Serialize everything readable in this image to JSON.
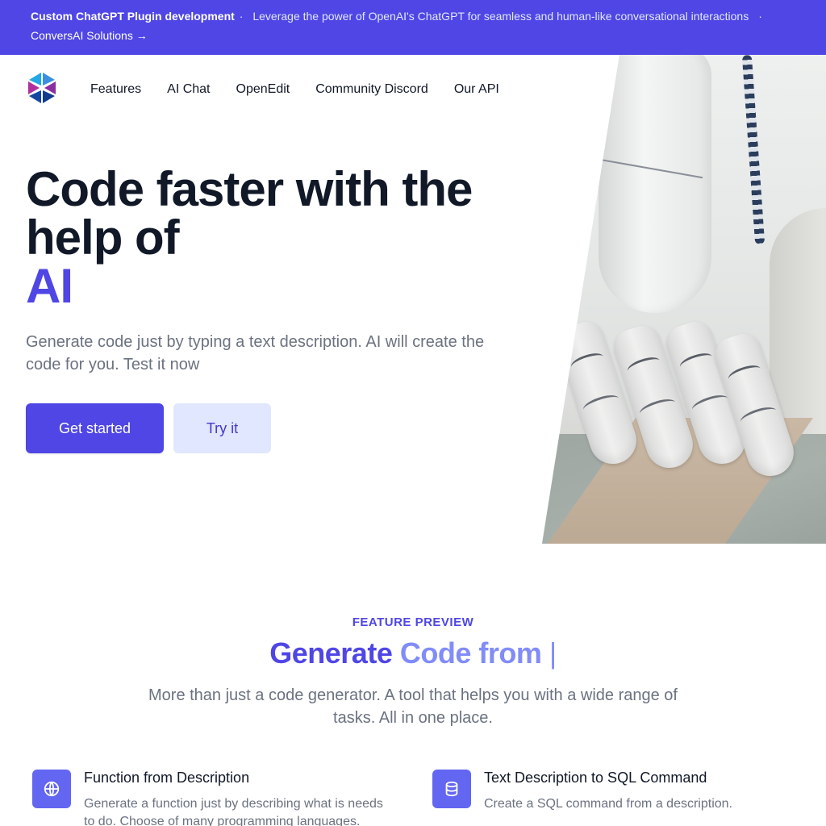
{
  "banner": {
    "headline": "Custom ChatGPT Plugin development",
    "separator": "·",
    "text": "Leverage the power of OpenAI's ChatGPT for seamless and human-like conversational interactions",
    "link_label": "ConversAI Solutions →"
  },
  "nav": {
    "logo_icon": "hexagon-logo-icon",
    "items": [
      {
        "label": "Features"
      },
      {
        "label": "AI Chat"
      },
      {
        "label": "OpenEdit"
      },
      {
        "label": "Community Discord"
      },
      {
        "label": "Our API"
      }
    ]
  },
  "hero": {
    "title_line1": "Code faster with the help of",
    "title_accent": "AI",
    "subtitle": "Generate code just by typing a text description. AI will create the code for you. Test it now",
    "primary_button": "Get started",
    "secondary_button": "Try it",
    "image_alt": "Robot hand"
  },
  "features": {
    "eyebrow": "FEATURE PREVIEW",
    "title_part1": "Generate",
    "title_part2": "Code from",
    "title_cursor": "|",
    "subtitle": "More than just a code generator. A tool that helps you with a wide range of tasks. All in one place.",
    "items": [
      {
        "icon": "globe-icon",
        "title": "Function from Description",
        "description": "Generate a function just by describing what is needs to do. Choose of many programming languages."
      },
      {
        "icon": "database-icon",
        "title": "Text Description to SQL Command",
        "description": "Create a SQL command from a description."
      }
    ]
  },
  "colors": {
    "brand": "#4f46e5",
    "brand_light": "#818cf8",
    "icon_bg": "#6366f1",
    "secondary_button_bg": "#e0e7ff",
    "text_dark": "#111827",
    "text_muted": "#6b7280"
  }
}
